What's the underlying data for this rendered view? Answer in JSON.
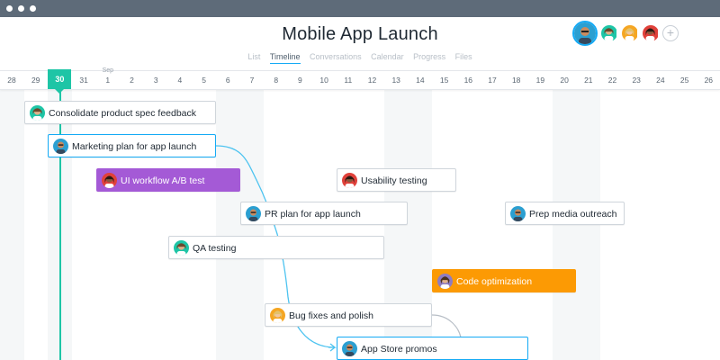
{
  "window": {
    "title": "Mobile App Launch"
  },
  "tabs": [
    {
      "label": "List",
      "active": false
    },
    {
      "label": "Timeline",
      "active": true
    },
    {
      "label": "Conversations",
      "active": false
    },
    {
      "label": "Calendar",
      "active": false
    },
    {
      "label": "Progress",
      "active": false
    },
    {
      "label": "Files",
      "active": false
    }
  ],
  "members": {
    "add_icon": "plus-icon",
    "avatars": [
      {
        "kind": "avatar",
        "bg": "#2b9fd1",
        "skin": "#c98a5e"
      },
      {
        "kind": "avatar",
        "bg": "#1ec5a6",
        "skin": "#e0b08a"
      },
      {
        "kind": "avatar",
        "bg": "#f5a623",
        "skin": "#f0c7a0"
      },
      {
        "kind": "avatar",
        "bg": "#e0413a",
        "skin": "#8b5a3c"
      }
    ]
  },
  "timeline": {
    "month_label": "Sep",
    "today": "30",
    "days": [
      "28",
      "29",
      "30",
      "31",
      "1",
      "2",
      "3",
      "4",
      "5",
      "6",
      "7",
      "8",
      "9",
      "10",
      "11",
      "12",
      "13",
      "14",
      "15",
      "16",
      "17",
      "18",
      "19",
      "20",
      "21",
      "22",
      "23",
      "24",
      "25",
      "26"
    ]
  },
  "colors": {
    "accent": "#14aaf5",
    "today": "#1ec5a6",
    "purple_task": "#a45ad6",
    "orange_task": "#fc9a04"
  },
  "tasks": [
    {
      "label": "Consolidate product spec feedback",
      "style": "normal",
      "avatar_bg": "#1ec5a6"
    },
    {
      "label": "Marketing plan for app launch",
      "style": "selected",
      "avatar_bg": "#2b9fd1"
    },
    {
      "label": "UI workflow A/B test",
      "style": "purple",
      "avatar_bg": "#e0413a"
    },
    {
      "label": "Usability testing",
      "style": "normal",
      "avatar_bg": "#e0413a"
    },
    {
      "label": "PR plan for app launch",
      "style": "normal",
      "avatar_bg": "#2b9fd1"
    },
    {
      "label": "Prep media outreach",
      "style": "normal",
      "avatar_bg": "#2b9fd1"
    },
    {
      "label": "QA testing",
      "style": "normal",
      "avatar_bg": "#1ec5a6"
    },
    {
      "label": "Code optimization",
      "style": "orange",
      "avatar_bg": "#8e7cc3"
    },
    {
      "label": "Bug fixes and polish",
      "style": "normal",
      "avatar_bg": "#f5a623"
    },
    {
      "label": "App Store promos",
      "style": "selected",
      "avatar_bg": "#2b9fd1"
    }
  ]
}
